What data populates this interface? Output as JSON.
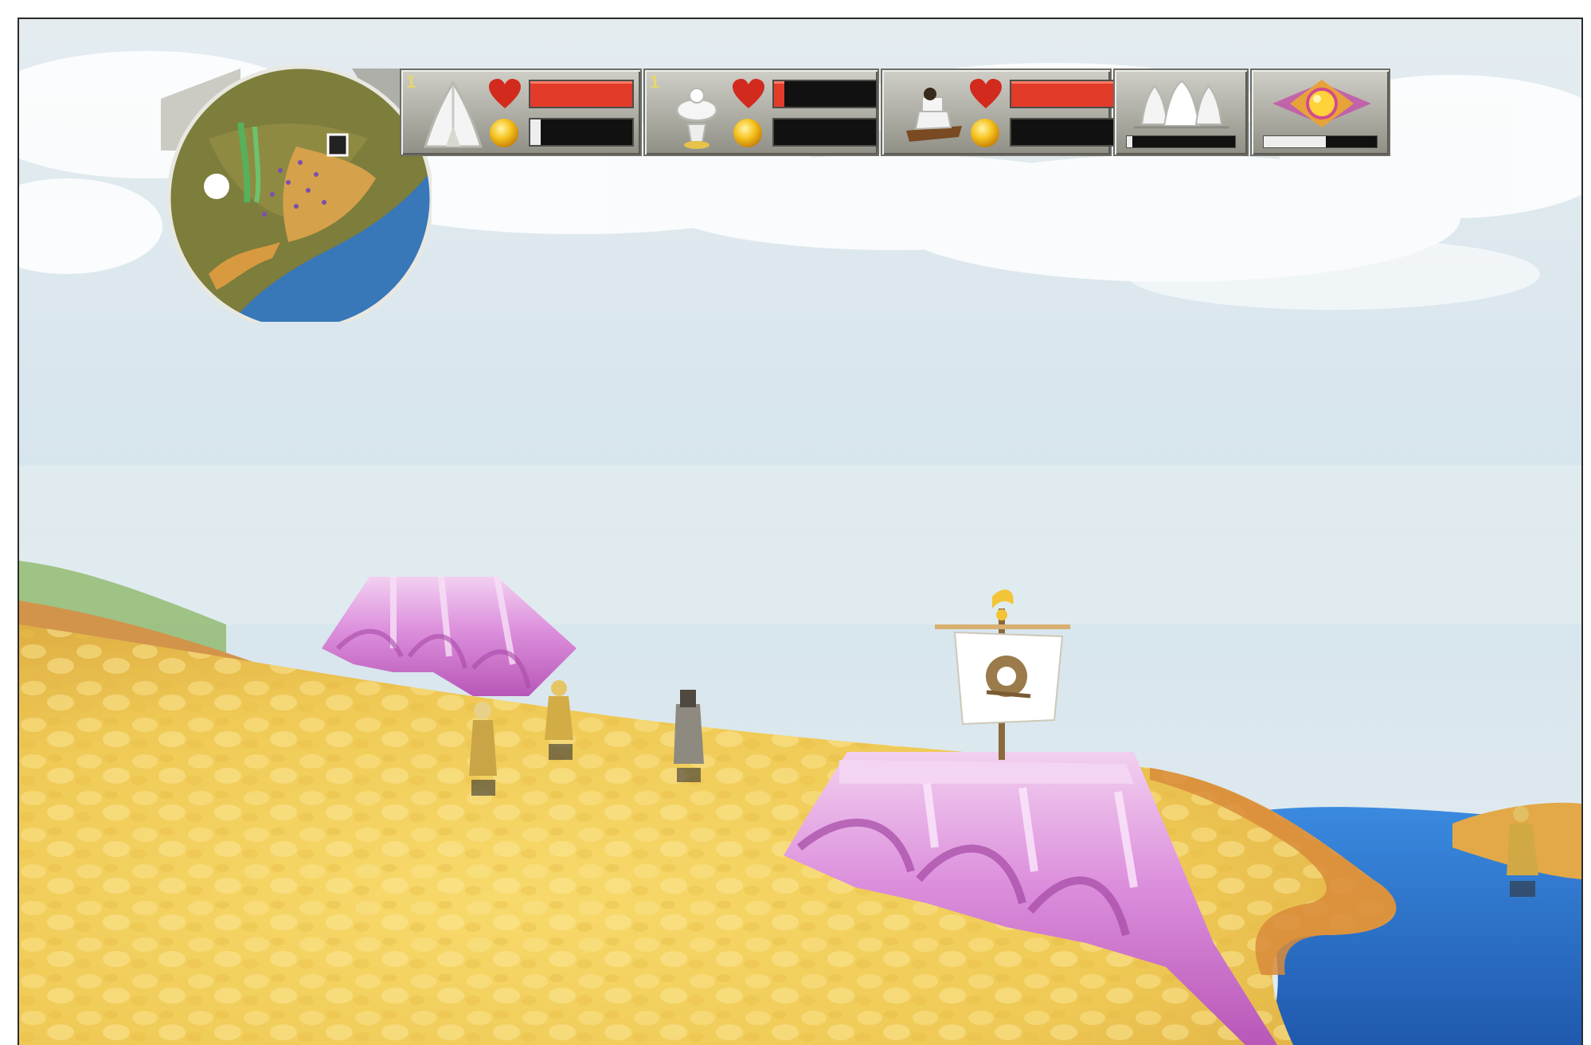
{
  "hud": {
    "minimap": {
      "icon": "globe-minimap"
    },
    "followers": [
      {
        "name": "braves",
        "icon": "brave-tent-icon",
        "count": "1",
        "health": 1.0,
        "mana": 0.1
      },
      {
        "name": "warriors",
        "icon": "warrior-icon",
        "count": "1",
        "health": 0.1,
        "mana": 0.0
      },
      {
        "name": "preachers",
        "icon": "preacher-icon",
        "count": "",
        "health": 1.0,
        "mana": 0.0
      }
    ],
    "buildings": {
      "icon": "huts-icon",
      "progress": 0.05
    },
    "shaman": {
      "icon": "shaman-gem-icon",
      "mana": 0.55
    }
  },
  "colors": {
    "health": "#e23b2a",
    "mana": "#eeeeee",
    "sand": "#f0cf5a",
    "sea": "#2b6fc0",
    "crystal": "#d77ed6"
  }
}
